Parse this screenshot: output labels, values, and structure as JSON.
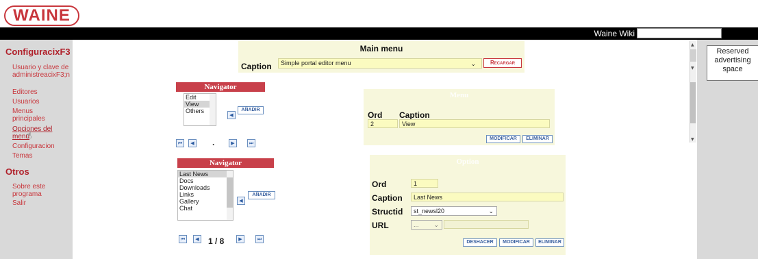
{
  "logo": {
    "text": "WAINE"
  },
  "topbar": {
    "wiki_label": "Waine Wiki",
    "wiki_input_value": ""
  },
  "sidebar": {
    "section1_title": "ConfiguracixF3",
    "items1": [
      "Usuario y clave de administreacixF3;n",
      "Editores",
      "Usuarios",
      "Menus principales",
      "Opciones del menu",
      "Configuracion",
      "Temas"
    ],
    "section2_title": "Otros",
    "items2": [
      "Sobre este programa",
      "Salir"
    ]
  },
  "main_menu": {
    "title": "Main menu",
    "caption_label": "Caption",
    "caption_value": "Simple portal editor menu",
    "reload_label": "Recargar"
  },
  "navigator1": {
    "title": "Navigator",
    "items": [
      "Edit",
      "View",
      "Others"
    ],
    "selected": "View",
    "add_label": "AÑADIR",
    "pager_text": "."
  },
  "menu_panel": {
    "title": "Menu",
    "ord_label": "Ord",
    "caption_label": "Caption",
    "ord_value": "2",
    "caption_value": "View",
    "modify_label": "MODIFICAR",
    "delete_label": "ELIMINAR"
  },
  "navigator2": {
    "title": "Navigator",
    "items": [
      "Last News",
      "Docs",
      "Downloads",
      "Links",
      "Gallery",
      "Chat"
    ],
    "selected": "Last News",
    "add_label": "AÑADIR",
    "pager_text": "1 / 8"
  },
  "option_panel": {
    "title": "Option",
    "ord_label": "Ord",
    "caption_label": "Caption",
    "structid_label": "Structid",
    "url_label": "URL",
    "ord_value": "1",
    "caption_value": "Last News",
    "structid_value": "st_newsl20",
    "url_select_value": "...",
    "url_value": "",
    "undo_label": "DESHACER",
    "modify_label": "MODIFICAR",
    "delete_label": "ELIMINAR"
  },
  "ad": {
    "text": "Reserved advertising space"
  },
  "colors": {
    "brand": "#c8363c",
    "panel": "#f7f7dc",
    "field": "#fbfbc0",
    "button_blue": "#3c62a0"
  }
}
